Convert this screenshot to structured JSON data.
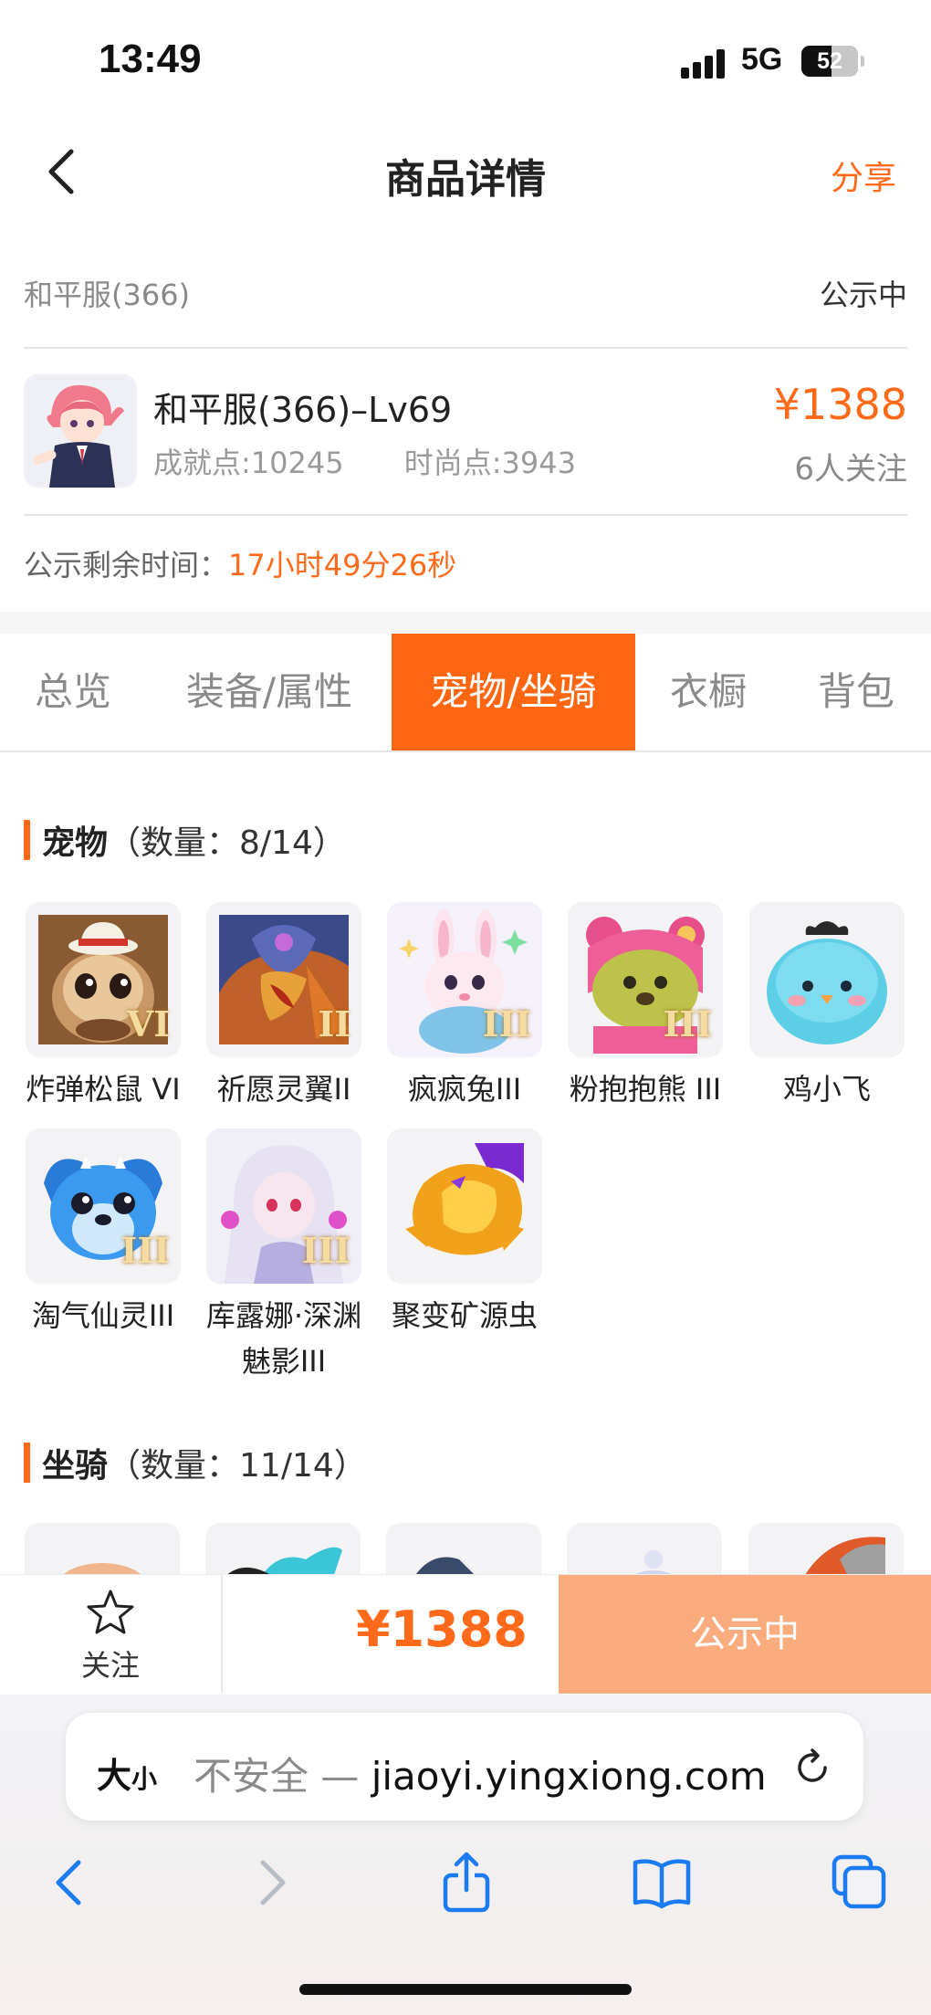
{
  "status_bar": {
    "time": "13:49",
    "network": "5G",
    "battery": "52"
  },
  "navbar": {
    "title": "商品详情",
    "share": "分享"
  },
  "listing": {
    "server": "和平服(366)",
    "state": "公示中",
    "name": "和平服(366)–Lv69",
    "achievement": "成就点:10245",
    "fashion": "时尚点:3943",
    "price": "¥1388",
    "followers": "6人关注",
    "remaining_label": "公示剩余时间：",
    "remaining_value": "17小时49分26秒"
  },
  "tabs": [
    "总览",
    "装备/属性",
    "宠物/坐骑",
    "衣橱",
    "背包"
  ],
  "active_tab": "宠物/坐骑",
  "pets_section": {
    "title": "宠物",
    "count": "（数量：8/14）"
  },
  "pets": [
    {
      "name": "炸弹松鼠 VI",
      "tier": "VI",
      "icon": "squirrel-pet-icon"
    },
    {
      "name": "祈愿灵翼II",
      "tier": "II",
      "icon": "eagle-pet-icon"
    },
    {
      "name": "疯疯兔III",
      "tier": "III",
      "icon": "rabbit-pet-icon"
    },
    {
      "name": "粉抱抱熊 III",
      "tier": "III",
      "icon": "bear-pet-icon"
    },
    {
      "name": "鸡小飞",
      "tier": "",
      "icon": "chick-pet-icon"
    },
    {
      "name": "淘气仙灵III",
      "tier": "III",
      "icon": "fairy-dog-pet-icon"
    },
    {
      "name": "库露娜·深渊魅影III",
      "tier": "III",
      "icon": "girl-pet-icon"
    },
    {
      "name": "聚变矿源虫",
      "tier": "",
      "icon": "crystal-bug-pet-icon"
    }
  ],
  "mounts_section": {
    "title": "坐骑",
    "count": "（数量：11/14）"
  },
  "bottom_bar": {
    "follow_label": "关注",
    "price": "¥1388",
    "action": "公示中"
  },
  "browser": {
    "text_size": "大",
    "text_size_small": "小",
    "insecure": "不安全 — ",
    "host": "jiaoyi.yingxiong.com"
  },
  "colors": {
    "accent": "#ff6a1a",
    "active_tab": "#ff6612",
    "action_button": "#fbac7f",
    "browser_blue": "#1a7cf0"
  }
}
